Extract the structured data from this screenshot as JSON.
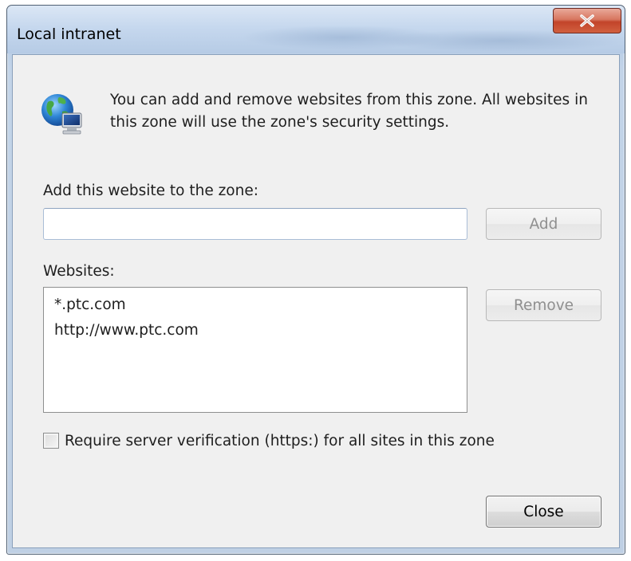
{
  "window": {
    "title": "Local intranet"
  },
  "info": {
    "icon": "globe-computer-icon",
    "description": "You can add and remove websites from this zone. All websites in this zone will use the zone's security settings."
  },
  "add_section": {
    "label": "Add this website to the zone:",
    "input_value": "",
    "add_button": "Add"
  },
  "websites_section": {
    "label": "Websites:",
    "items": [
      "*.ptc.com",
      "http://www.ptc.com"
    ],
    "remove_button": "Remove"
  },
  "https_option": {
    "label": "Require server verification (https:) for all sites in this zone",
    "checked": false
  },
  "footer": {
    "close_button": "Close"
  },
  "colors": {
    "close_button_red": "#c2442a",
    "client_background": "#f0f0f0",
    "frame_blue": "#bfd0e4"
  }
}
